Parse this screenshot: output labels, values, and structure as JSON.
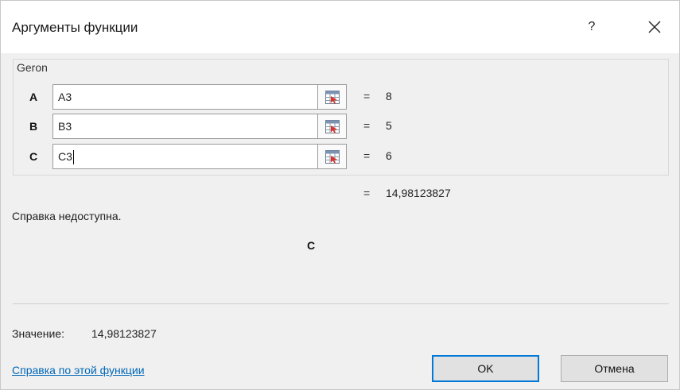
{
  "window": {
    "title": "Аргументы функции",
    "help_glyph": "?",
    "close_icon": "close-icon"
  },
  "function": {
    "name": "Geron",
    "args": [
      {
        "label": "A",
        "value": "A3",
        "result": "8"
      },
      {
        "label": "B",
        "value": "B3",
        "result": "5"
      },
      {
        "label": "C",
        "value": "C3",
        "result": "6"
      }
    ],
    "equals": "=",
    "result": "14,98123827",
    "description": "Справка недоступна.",
    "current_param": "C"
  },
  "footer": {
    "value_label": "Значение:",
    "value": "14,98123827",
    "help_link": "Справка по этой функции",
    "ok_label": "OK",
    "cancel_label": "Отмена"
  },
  "colors": {
    "link": "#0067b8",
    "default_button_border": "#0078d7",
    "ref_icon_accent": "#d9342b"
  }
}
